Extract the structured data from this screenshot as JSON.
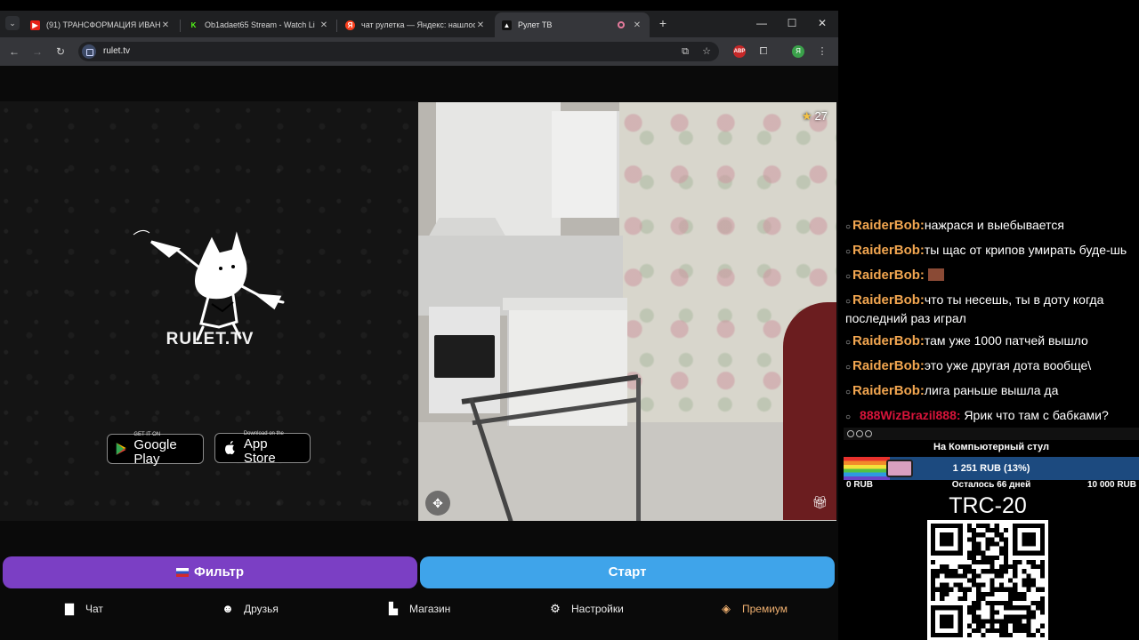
{
  "browser": {
    "tabs": [
      {
        "title": "(91) ТРАНСФОРМАЦИЯ ИВАНА",
        "favicon": "youtube-icon",
        "active": false
      },
      {
        "title": "Ob1adaet65 Stream - Watch Li",
        "favicon": "kick-icon",
        "active": false
      },
      {
        "title": "чат рулетка — Яндекс: нашлос",
        "favicon": "yandex-icon",
        "active": false
      },
      {
        "title": "Рулет ТВ",
        "favicon": "rulet-icon",
        "active": true
      }
    ],
    "url": "rulet.tv",
    "profile_initial": "Я",
    "abp_label": "ABP"
  },
  "site": {
    "logo_text": "RULET.TV",
    "google_play": {
      "small": "GET IT ON",
      "big": "Google Play"
    },
    "app_store": {
      "small": "Download on the",
      "big": "App Store"
    },
    "video": {
      "stars": "27"
    },
    "filter_label": "Фильтр",
    "start_label": "Старт",
    "nav": [
      {
        "label": "Чат",
        "icon": "chat-icon"
      },
      {
        "label": "Друзья",
        "icon": "friends-icon"
      },
      {
        "label": "Магазин",
        "icon": "shop-bag-icon"
      },
      {
        "label": "Настройки",
        "icon": "gear-icon"
      },
      {
        "label": "Премиум",
        "icon": "tag-icon"
      }
    ]
  },
  "stream_chat": {
    "messages": [
      {
        "user": "RaiderBob:",
        "text": "нажрася и выебывается"
      },
      {
        "user": "RaiderBob:",
        "text": "ты щас от крипов умирать буде-шь"
      },
      {
        "user": "RaiderBob:",
        "text": ""
      },
      {
        "user": "RaiderBob:",
        "text": "что ты несешь, ты в доту когда последний раз играл"
      },
      {
        "user": "RaiderBob:",
        "text": "там уже 1000 патчей вышло"
      },
      {
        "user": "RaiderBob:",
        "text": "это уже другая дота вообще\\"
      },
      {
        "user": "RaiderBob:",
        "text": "лига раньше вышла да"
      },
      {
        "user": "888WizBrazil888:",
        "text": " Ярик что там с бабками?"
      }
    ]
  },
  "donation_goal": {
    "title": "На Компьютерный стул",
    "progress_text": "1 251 RUB (13%)",
    "progress_fraction": 0.13,
    "min_label": "0 RUB",
    "remaining_label": "Осталось 66 дней",
    "max_label": "10 000 RUB"
  },
  "crypto_label": "TRC-20",
  "colors": {
    "username": "#f2a650",
    "username_alt": "#d8143a",
    "filter_button": "#7b3fc4",
    "start_button": "#3fa4ea",
    "premium": "#f0b070"
  }
}
